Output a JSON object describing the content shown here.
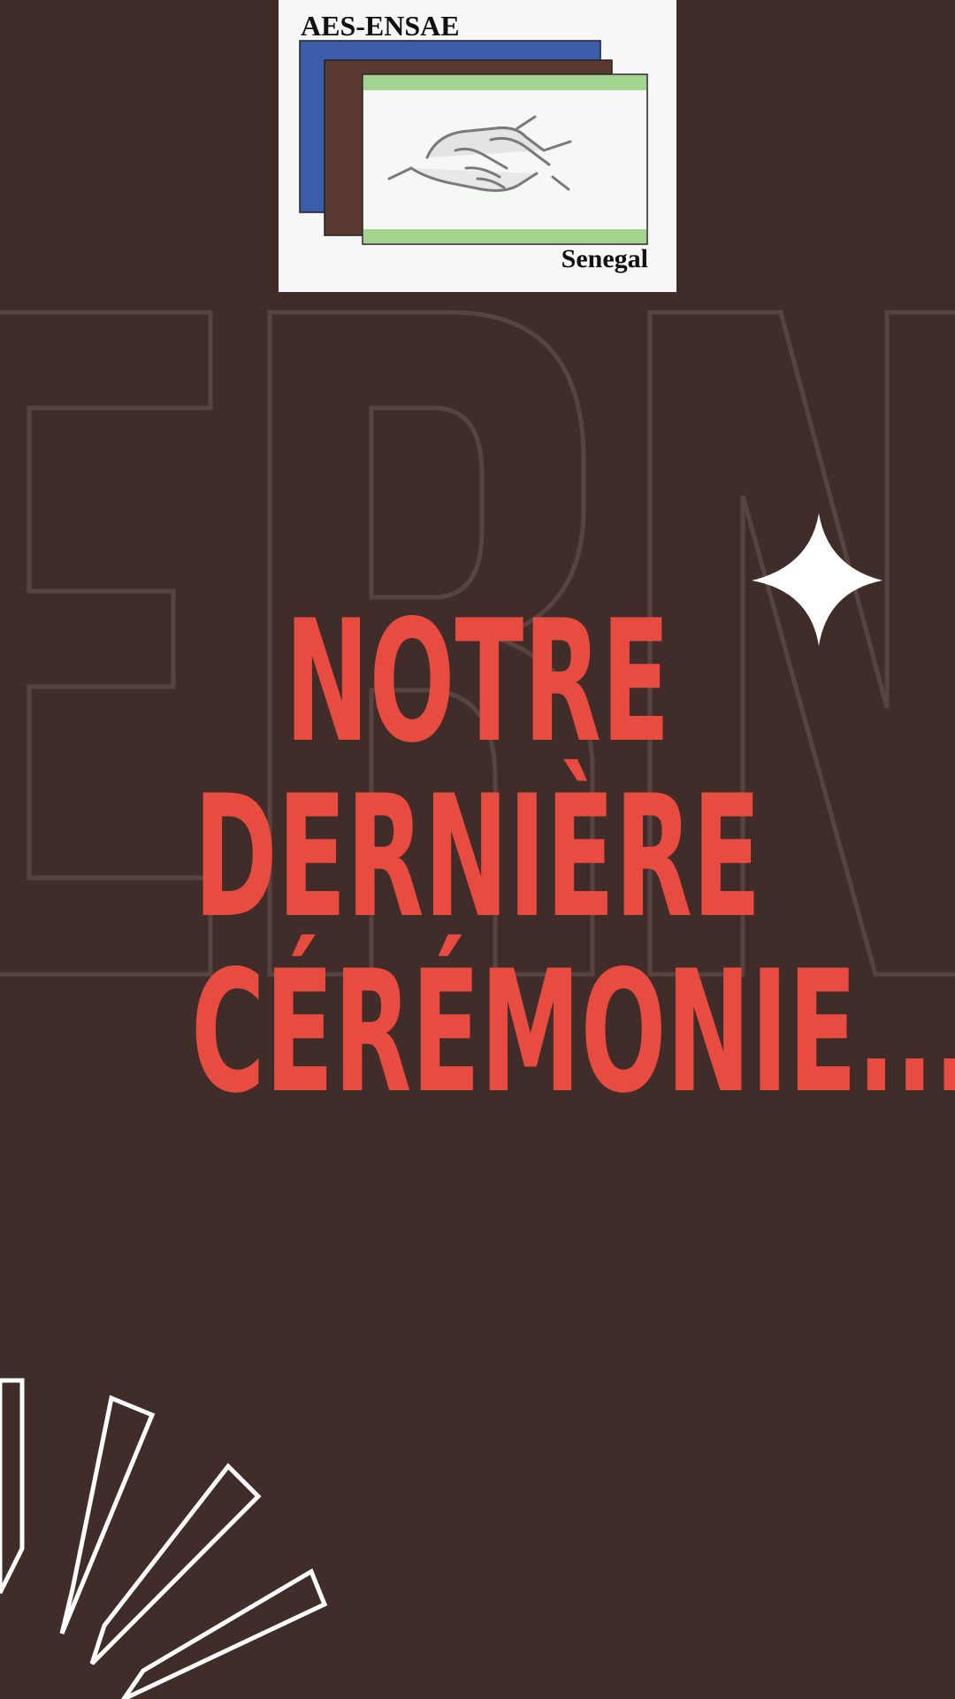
{
  "logo": {
    "top_text": "AES-ENSAE",
    "bottom_text": "Senegal",
    "image": "handshake-illustration",
    "colors": {
      "blue": "#3b5ca8",
      "brown": "#5a3a30",
      "green": "#a3d48f"
    }
  },
  "headline": {
    "line1": "NOTRE",
    "line2": "DERNIÈRE",
    "line3": "CÉRÉMONIE..."
  },
  "background_letters": "ERN",
  "decorations": [
    "sparkle-icon",
    "burst-rays"
  ],
  "colors": {
    "background": "#402d29",
    "headline": "#e84c40",
    "outline": "#574440",
    "accent": "#ffffff"
  }
}
